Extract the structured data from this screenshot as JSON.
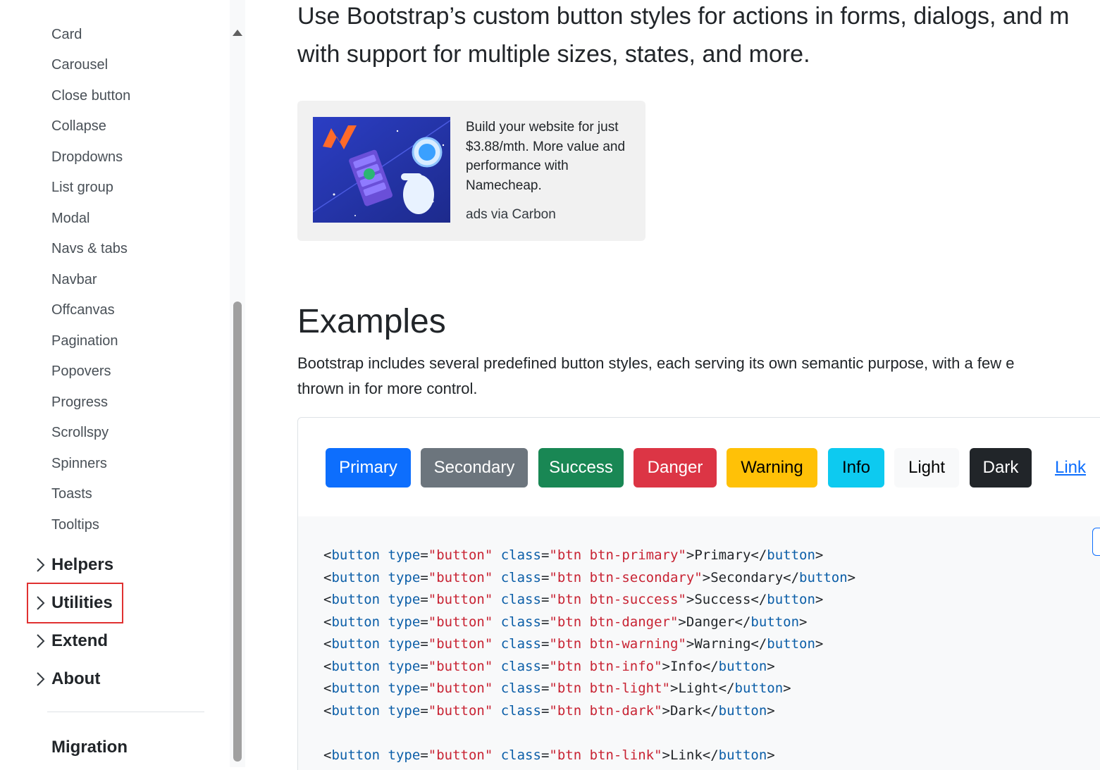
{
  "sidebar": {
    "items": [
      "Card",
      "Carousel",
      "Close button",
      "Collapse",
      "Dropdowns",
      "List group",
      "Modal",
      "Navs & tabs",
      "Navbar",
      "Offcanvas",
      "Pagination",
      "Popovers",
      "Progress",
      "Scrollspy",
      "Spinners",
      "Toasts",
      "Tooltips"
    ],
    "groups": [
      "Helpers",
      "Utilities",
      "Extend",
      "About"
    ],
    "highlighted_group": "Utilities",
    "bottom_item": "Migration"
  },
  "main": {
    "lead": {
      "line1": "Use Bootstrap’s custom button styles for actions in forms, dialogs, and m",
      "line2": "with support for multiple sizes, states, and more."
    },
    "ad": {
      "text": "Build your website for just $3.88/mth. More value and performance with Namecheap.",
      "via": "ads via Carbon"
    },
    "examples": {
      "title": "Examples",
      "description_line1": "Bootstrap includes several predefined button styles, each serving its own semantic purpose, with a few e",
      "description_line2": "thrown in for more control."
    },
    "buttons": [
      {
        "label": "Primary",
        "bg": "#0d6efd",
        "fg": "#ffffff"
      },
      {
        "label": "Secondary",
        "bg": "#6c757d",
        "fg": "#ffffff"
      },
      {
        "label": "Success",
        "bg": "#198754",
        "fg": "#ffffff"
      },
      {
        "label": "Danger",
        "bg": "#dc3545",
        "fg": "#ffffff"
      },
      {
        "label": "Warning",
        "bg": "#ffc107",
        "fg": "#000000"
      },
      {
        "label": "Info",
        "bg": "#0dcaf0",
        "fg": "#000000"
      },
      {
        "label": "Light",
        "bg": "#f8f9fa",
        "fg": "#000000"
      },
      {
        "label": "Dark",
        "bg": "#212529",
        "fg": "#ffffff"
      },
      {
        "label": "Link",
        "bg": "transparent",
        "fg": "#0d6efd"
      }
    ],
    "code_lines": [
      {
        "cls": "btn btn-primary",
        "text": "Primary"
      },
      {
        "cls": "btn btn-secondary",
        "text": "Secondary"
      },
      {
        "cls": "btn btn-success",
        "text": "Success"
      },
      {
        "cls": "btn btn-danger",
        "text": "Danger"
      },
      {
        "cls": "btn btn-warning",
        "text": "Warning"
      },
      {
        "cls": "btn btn-info",
        "text": "Info"
      },
      {
        "cls": "btn btn-light",
        "text": "Light"
      },
      {
        "cls": "btn btn-dark",
        "text": "Dark"
      },
      {
        "cls": "",
        "text": ""
      },
      {
        "cls": "btn btn-link",
        "text": "Link"
      }
    ]
  }
}
